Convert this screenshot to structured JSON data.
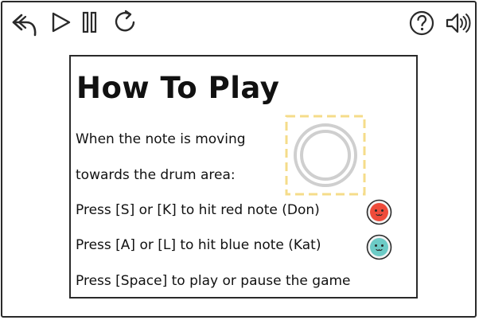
{
  "toolbar": {
    "back_icon": "back-arrow-icon",
    "play_icon": "play-icon",
    "pause_icon": "pause-icon",
    "restart_icon": "restart-icon",
    "help_icon": "help-icon",
    "sound_icon": "speaker-icon"
  },
  "panel": {
    "title": "How To Play",
    "lines": [
      "When the note is moving",
      "towards the drum area:",
      "Press [S] or [K] to hit red note (Don)",
      "Press [A] or [L] to hit blue note (Kat)",
      "Press [Space] to play or pause the game"
    ]
  },
  "colors": {
    "red_note": "#ee4b3a",
    "blue_note": "#6ccbc6",
    "drum_area_border": "#f5dc8a",
    "drum_ring": "#cfcfcf",
    "outline": "#2a2a2a"
  }
}
